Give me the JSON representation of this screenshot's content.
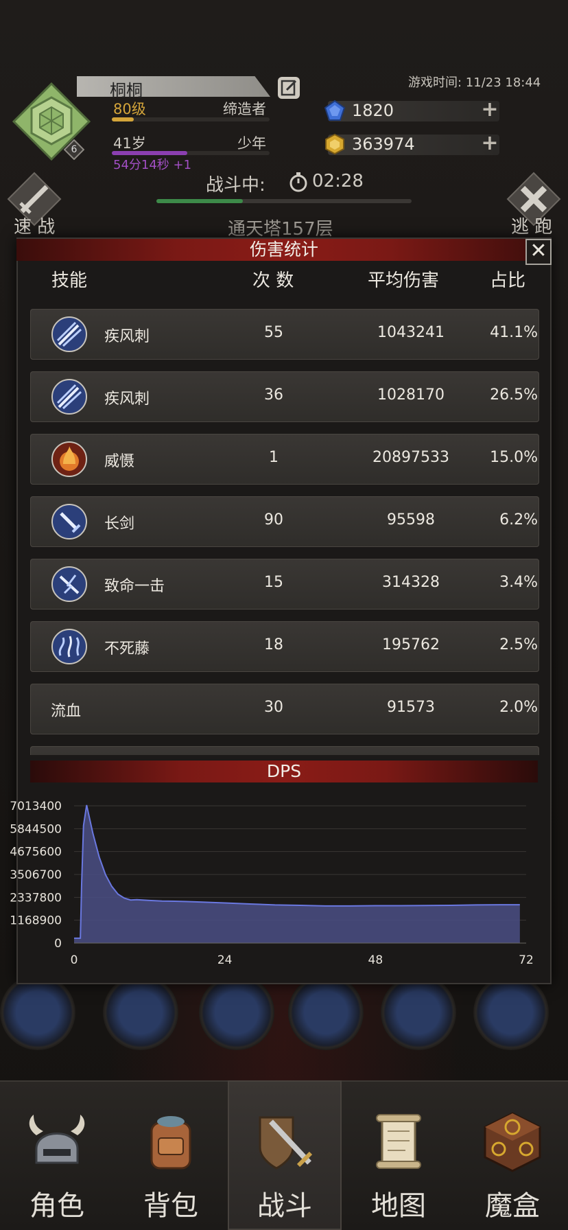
{
  "header": {
    "player_name": "桐桐",
    "level_text": "80级",
    "class_text": "缔造者",
    "age_text": "41岁",
    "stage_text": "少年",
    "timer_text": "54分14秒 +1",
    "badge_level": "6",
    "game_time": "游戏时间: 11/23 18:44",
    "gems": "1820",
    "gold": "363974",
    "battle_label": "战斗中:",
    "battle_time": "02:28",
    "quick_battle": "速 战",
    "escape": "逃 跑",
    "tower": "通天塔157层",
    "colors": {
      "gem": "#3f6fd6",
      "gold": "#d7a82f",
      "progress": "#3d8a49",
      "timer": "#a24fc4"
    }
  },
  "damage_panel": {
    "title": "伤害统计",
    "close": "✕",
    "columns": {
      "skill": "技能",
      "count": "次 数",
      "avg": "平均伤害",
      "share": "占比"
    },
    "rows": [
      {
        "icon": "blade-storm-icon",
        "name": "疾风刺",
        "count": "55",
        "avg": "1043241",
        "share": "41.1%"
      },
      {
        "icon": "blade-storm-icon",
        "name": "疾风刺",
        "count": "36",
        "avg": "1028170",
        "share": "26.5%"
      },
      {
        "icon": "fire-aura-icon",
        "name": "威慑",
        "count": "1",
        "avg": "20897533",
        "share": "15.0%"
      },
      {
        "icon": "sword-icon",
        "name": "长剑",
        "count": "90",
        "avg": "95598",
        "share": "6.2%"
      },
      {
        "icon": "critical-strike-icon",
        "name": "致命一击",
        "count": "15",
        "avg": "314328",
        "share": "3.4%"
      },
      {
        "icon": "lightning-vine-icon",
        "name": "不死藤",
        "count": "18",
        "avg": "195762",
        "share": "2.5%"
      },
      {
        "icon": "",
        "name": "流血",
        "count": "30",
        "avg": "91573",
        "share": "2.0%"
      }
    ]
  },
  "dps": {
    "title": "DPS"
  },
  "chart_data": {
    "type": "area",
    "title": "DPS",
    "xlabel": "",
    "ylabel": "",
    "xlim": [
      0,
      72
    ],
    "ylim": [
      0,
      7013400
    ],
    "xticks": [
      "0",
      "24",
      "48",
      "72"
    ],
    "yticks": [
      "7013400",
      "5844500",
      "4675600",
      "3506700",
      "2337800",
      "1168900",
      "0"
    ],
    "x": [
      0,
      1,
      1.2,
      1.5,
      2,
      3,
      4,
      5,
      6,
      7,
      8,
      9,
      10,
      12,
      14,
      16,
      18,
      20,
      24,
      28,
      32,
      36,
      40,
      44,
      48,
      52,
      56,
      60,
      64,
      68,
      71
    ],
    "values": [
      250000,
      250000,
      3000000,
      6000000,
      7050000,
      5600000,
      4400000,
      3500000,
      2900000,
      2500000,
      2300000,
      2200000,
      2220000,
      2180000,
      2150000,
      2140000,
      2120000,
      2100000,
      2050000,
      2000000,
      1950000,
      1930000,
      1900000,
      1900000,
      1910000,
      1910000,
      1920000,
      1930000,
      1950000,
      1960000,
      1960000
    ],
    "grid": true,
    "fill_color": "#4a4f85",
    "line_color": "#6a78e0"
  },
  "nav": {
    "items": [
      {
        "label": "角色",
        "icon": "helmet-icon"
      },
      {
        "label": "背包",
        "icon": "backpack-icon"
      },
      {
        "label": "战斗",
        "icon": "shield-sword-icon",
        "active": true
      },
      {
        "label": "地图",
        "icon": "scroll-map-icon"
      },
      {
        "label": "魔盒",
        "icon": "magic-box-icon"
      }
    ]
  }
}
